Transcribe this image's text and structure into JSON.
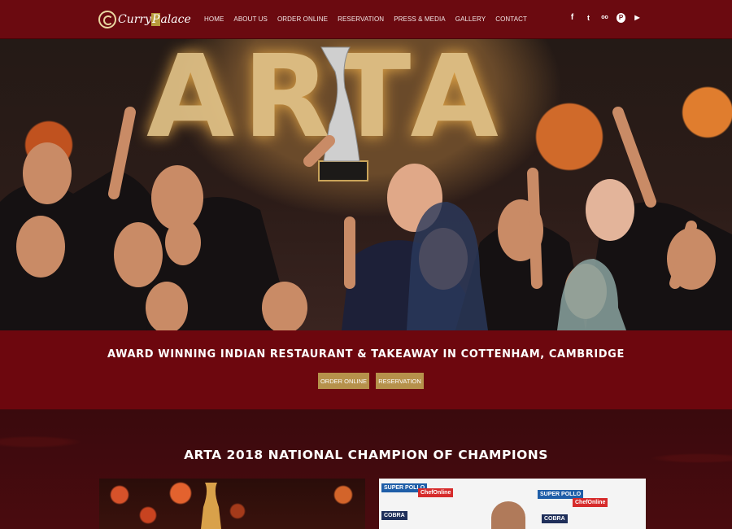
{
  "header": {
    "logo": {
      "text_a": "Curry",
      "text_b": "P",
      "text_c": "alace"
    },
    "nav": [
      "HOME",
      "ABOUT US",
      "ORDER ONLINE",
      "RESERVATION",
      "PRESS & MEDIA",
      "GALLERY",
      "CONTACT"
    ],
    "social": [
      {
        "icon": "facebook-icon",
        "glyph": "f"
      },
      {
        "icon": "twitter-icon",
        "glyph": "t"
      },
      {
        "icon": "tripadvisor-icon",
        "glyph": "oo"
      },
      {
        "icon": "pinterest-icon",
        "glyph": "P"
      },
      {
        "icon": "youtube-icon",
        "glyph": "▶"
      }
    ]
  },
  "hero": {
    "backdrop_text": "ARTA"
  },
  "banner": {
    "title": "AWARD WINNING INDIAN RESTAURANT & TAKEAWAY IN COTTENHAM, CAMBRIDGE",
    "order_button": "ORDER ONLINE",
    "reservation_button": "RESERVATION"
  },
  "section": {
    "title": "ARTA 2018 NATIONAL CHAMPION OF CHAMPIONS",
    "sponsors": [
      "SUPER POLLO",
      "ChefOnline",
      "COBRA",
      "SUPER POLLO",
      "ChefOnline",
      "COBRA"
    ]
  },
  "colors": {
    "header_bg": "#6b0a10",
    "banner_bg": "#6d070e",
    "button_bg": "#b6914b",
    "section_bg": "#3a0a0d"
  }
}
